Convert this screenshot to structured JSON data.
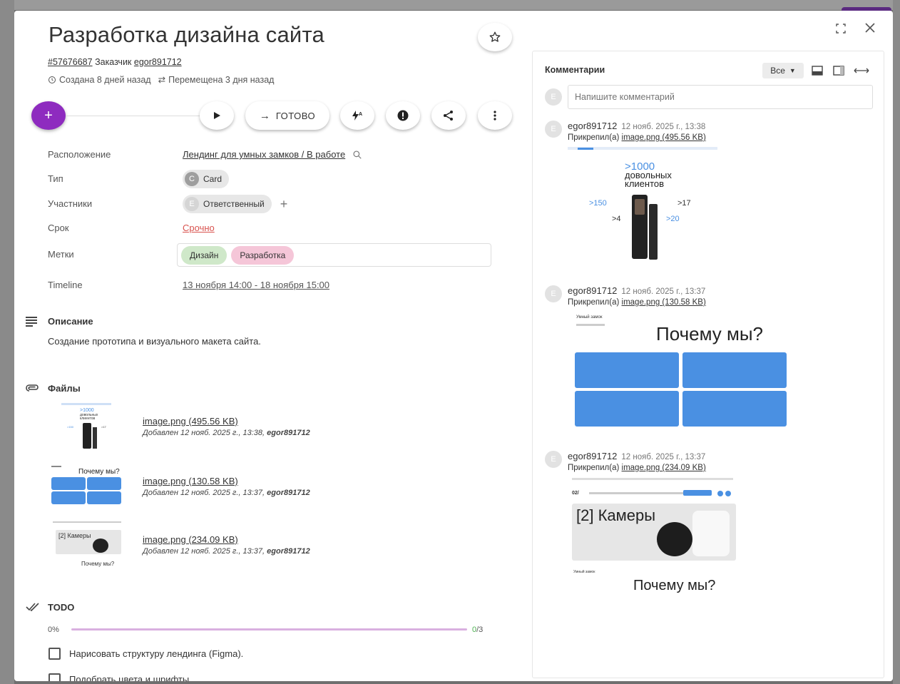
{
  "task": {
    "title": "Разработка дизайна сайта",
    "id_link": "#57676687",
    "customer_label": "Заказчик",
    "customer": "egor891712",
    "created": "Создана 8 дней назад",
    "moved": "Перемещена 3 дня назад"
  },
  "actions": {
    "done_label": "ГОТОВО"
  },
  "props": {
    "location_label": "Расположение",
    "location_value": "Лендинг для умных замков / В работе",
    "type_label": "Тип",
    "type_avatar": "C",
    "type_value": "Card",
    "members_label": "Участники",
    "members_avatar": "E",
    "members_value": "Ответственный",
    "due_label": "Срок",
    "due_value": "Срочно",
    "tags_label": "Метки",
    "tags": [
      {
        "label": "Дизайн",
        "color": "#cfe8c9"
      },
      {
        "label": "Разработка",
        "color": "#f5c6d8"
      }
    ],
    "timeline_label": "Timeline",
    "timeline_value": "13 ноября 14:00 - 18 ноября 15:00"
  },
  "description": {
    "heading": "Описание",
    "text": "Создание прототипа и визуального макета сайта."
  },
  "files": {
    "heading": "Файлы",
    "items": [
      {
        "name": "image.png (495.56 KB)",
        "added": "Добавлен 12 нояб. 2025 г., 13:38,",
        "by": "egor891712"
      },
      {
        "name": "image.png (130.58 KB)",
        "added": "Добавлен 12 нояб. 2025 г., 13:37,",
        "by": "egor891712"
      },
      {
        "name": "image.png (234.09 KB)",
        "added": "Добавлен 12 нояб. 2025 г., 13:37,",
        "by": "egor891712"
      }
    ]
  },
  "todo": {
    "heading": "TODO",
    "percent": "0%",
    "progress": 0,
    "done": "0",
    "total": "/3",
    "items": [
      "Нарисовать структуру лендинга (Figma).",
      "Подобрать цвета и шрифты."
    ]
  },
  "comments": {
    "title": "Комментарии",
    "filter": "Все",
    "avatar": "E",
    "placeholder": "Напишите комментарий",
    "entries": [
      {
        "author": "egor891712",
        "time": "12 нояб. 2025 г., 13:38",
        "attached": "Прикрепил(а)",
        "file": "image.png (495.56 KB)"
      },
      {
        "author": "egor891712",
        "time": "12 нояб. 2025 г., 13:37",
        "attached": "Прикрепил(а)",
        "file": "image.png (130.58 KB)"
      },
      {
        "author": "egor891712",
        "time": "12 нояб. 2025 г., 13:37",
        "attached": "Прикрепил(а)",
        "file": "image.png (234.09 KB)"
      }
    ]
  },
  "thumbs": {
    "stat_main": ">1000",
    "stat_main_caption": "довольных клиентов",
    "stat_150": ">150",
    "stat_17": ">17",
    "stat_4": ">4",
    "stat_20": ">20",
    "why": "Почему мы?",
    "cameras": "[2] Камеры",
    "smart_lock": "Умный замок",
    "page_no": "02/"
  },
  "colors": {
    "accent": "#8e2bbf",
    "urgent": "#d9534f",
    "blue": "#4a90e2"
  }
}
